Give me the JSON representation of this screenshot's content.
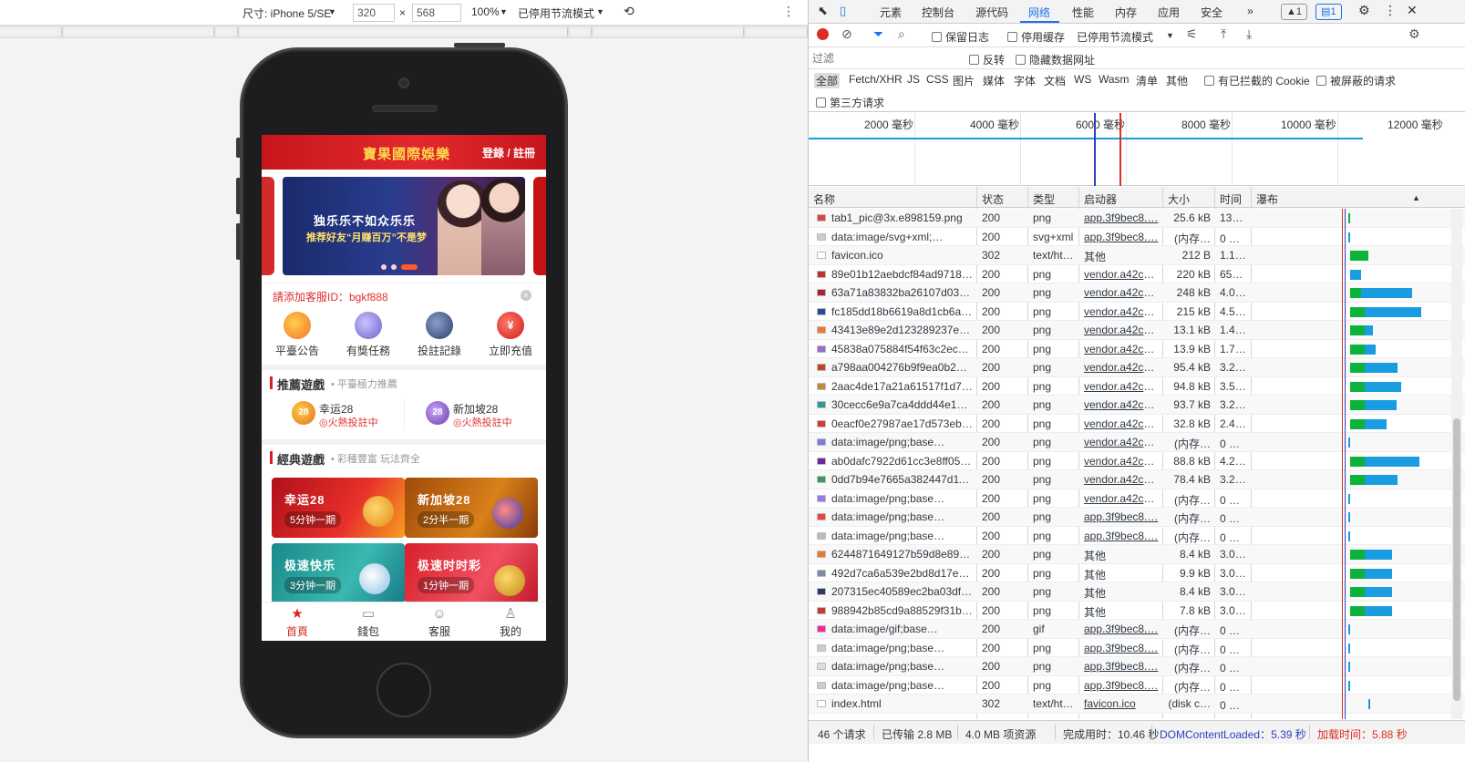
{
  "emulation": {
    "device_label": "尺寸: iPhone 5/SE",
    "width": "320",
    "height": "568",
    "times": "×",
    "zoom": "100%",
    "throttle": "已停用节流模式",
    "more": "⋮",
    "rotate": "⟲"
  },
  "app": {
    "title": "寶果國際娛樂",
    "login": "登錄 / 註冊",
    "banner_line1": "独乐乐不如众乐乐",
    "banner_line2": "推荐好友“月赚百万”不是梦",
    "notice": "請添加客服ID：bgkf888",
    "notice_close": "×",
    "quick": [
      {
        "label": "平臺公告",
        "icon": "smile-icon"
      },
      {
        "label": "有獎任務",
        "icon": "gift-stack-icon"
      },
      {
        "label": "投註記錄",
        "icon": "record-icon"
      },
      {
        "label": "立即充值",
        "icon": "yen-icon"
      }
    ],
    "rec_title": "推薦遊戲",
    "rec_sub": "• 平臺極力推薦",
    "rec": [
      {
        "name": "幸运28",
        "status": "◎火熱投註中",
        "ball": "28"
      },
      {
        "name": "新加坡28",
        "status": "◎火熱投註中",
        "ball": "28"
      }
    ],
    "classic_title": "經典遊戲",
    "classic_sub": "• 彩種豐富 玩法齊全",
    "games": [
      {
        "name": "幸运28",
        "period": "5分钟一期"
      },
      {
        "name": "新加坡28",
        "period": "2分半一期"
      },
      {
        "name": "极速快乐",
        "period": "3分钟一期"
      },
      {
        "name": "极速时时彩",
        "period": "1分钟一期"
      }
    ],
    "tabs": [
      {
        "label": "首頁",
        "icon": "★"
      },
      {
        "label": "錢包",
        "icon": "▭"
      },
      {
        "label": "客服",
        "icon": "☺"
      },
      {
        "label": "我的",
        "icon": "♙"
      }
    ]
  },
  "devtools": {
    "tabs": [
      "元素",
      "控制台",
      "源代码",
      "网络",
      "性能",
      "内存",
      "应用",
      "安全"
    ],
    "tab_more": "»",
    "warn_badge": "▲1",
    "msg_badge": "▤1",
    "toolbar": {
      "preserve_log": "保留日志",
      "disable_cache": "停用缓存",
      "throttle": "已停用节流模式"
    },
    "filter_placeholder": "过滤",
    "invert": "反转",
    "hide_data_urls": "隐藏数据网址",
    "types": [
      "全部",
      "Fetch/XHR",
      "JS",
      "CSS",
      "图片",
      "媒体",
      "字体",
      "文档",
      "WS",
      "Wasm",
      "清单",
      "其他"
    ],
    "blocked_cookies": "有已拦截的 Cookie",
    "blocked_requests": "被屏蔽的请求",
    "third_party": "第三方请求",
    "timeline_ticks": [
      "2000 毫秒",
      "4000 毫秒",
      "6000 毫秒",
      "8000 毫秒",
      "10000 毫秒",
      "12000 毫秒"
    ],
    "columns": [
      "名称",
      "状态",
      "类型",
      "启动器",
      "大小",
      "时间",
      "瀑布"
    ],
    "rows": [
      {
        "name": "tab1_pic@3x.e898159.png",
        "status": "200",
        "type": "png",
        "initiator": "app.3f9bec8.…",
        "size": "25.6 kB",
        "time": "136 …",
        "icon": "#d44",
        "wf_start": 0.0,
        "wf_green": 0.03,
        "wf_blue": 0.0
      },
      {
        "name": "data:image/svg+xml;…",
        "status": "200",
        "type": "svg+xml",
        "initiator": "app.3f9bec8.…",
        "size": "(内存…",
        "time": "0 毫…",
        "icon": "#ccc",
        "wf_start": 0.0,
        "wf_green": 0.0,
        "wf_blue": 0.01
      },
      {
        "name": "favicon.ico",
        "status": "302",
        "type": "text/ht…",
        "initiator": "其他",
        "size": "212 B",
        "time": "1.18…",
        "icon": "#fff",
        "wf_start": 0.02,
        "wf_green": 0.25,
        "wf_blue": 0.0
      },
      {
        "name": "89e01b12aebdcf84ad97187…",
        "status": "200",
        "type": "png",
        "initiator": "vendor.a42c2e…",
        "size": "220 kB",
        "time": "659 …",
        "icon": "#b33",
        "wf_start": 0.02,
        "wf_green": 0.0,
        "wf_blue": 0.15
      },
      {
        "name": "63a71a83832ba26107d0385…",
        "status": "200",
        "type": "png",
        "initiator": "vendor.a42c2e…",
        "size": "248 kB",
        "time": "4.03…",
        "icon": "#a23",
        "wf_start": 0.02,
        "wf_green": 0.15,
        "wf_blue": 0.7
      },
      {
        "name": "fc185dd18b6619a8d1cb6a5…",
        "status": "200",
        "type": "png",
        "initiator": "vendor.a42c2e…",
        "size": "215 kB",
        "time": "4.55…",
        "icon": "#2a4c9a",
        "wf_start": 0.02,
        "wf_green": 0.2,
        "wf_blue": 0.78
      },
      {
        "name": "43413e89e2d123289237e07…",
        "status": "200",
        "type": "png",
        "initiator": "vendor.a42c2e…",
        "size": "13.1 kB",
        "time": "1.47…",
        "icon": "#e87a2a",
        "wf_start": 0.02,
        "wf_green": 0.2,
        "wf_blue": 0.12
      },
      {
        "name": "45838a075884f54f63c2ecd9…",
        "status": "200",
        "type": "png",
        "initiator": "vendor.a42c2e…",
        "size": "13.9 kB",
        "time": "1.70…",
        "icon": "#9a6acd",
        "wf_start": 0.02,
        "wf_green": 0.2,
        "wf_blue": 0.15
      },
      {
        "name": "a798aa004276b9f9ea0b2a4…",
        "status": "200",
        "type": "png",
        "initiator": "vendor.a42c2e…",
        "size": "95.4 kB",
        "time": "3.28…",
        "icon": "#c4402a",
        "wf_start": 0.02,
        "wf_green": 0.2,
        "wf_blue": 0.45
      },
      {
        "name": "2aac4de17a21a61517f1d7aa…",
        "status": "200",
        "type": "png",
        "initiator": "vendor.a42c2e…",
        "size": "94.8 kB",
        "time": "3.51…",
        "icon": "#c08a3a",
        "wf_start": 0.02,
        "wf_green": 0.2,
        "wf_blue": 0.5
      },
      {
        "name": "30cecc6e9a7ca4ddd44e13f3b…",
        "status": "200",
        "type": "png",
        "initiator": "vendor.a42c2e…",
        "size": "93.7 kB",
        "time": "3.26…",
        "icon": "#2a9a9a",
        "wf_start": 0.02,
        "wf_green": 0.2,
        "wf_blue": 0.44
      },
      {
        "name": "0eacf0e27987ae17d573eb41…",
        "status": "200",
        "type": "png",
        "initiator": "vendor.a42c2e…",
        "size": "32.8 kB",
        "time": "2.49…",
        "icon": "#d83a3a",
        "wf_start": 0.02,
        "wf_green": 0.2,
        "wf_blue": 0.3
      },
      {
        "name": "data:image/png;base…",
        "status": "200",
        "type": "png",
        "initiator": "vendor.a42c2e…",
        "size": "(内存…",
        "time": "0 毫…",
        "icon": "#7a7aea",
        "wf_start": 0.0,
        "wf_green": 0.0,
        "wf_blue": 0.01
      },
      {
        "name": "ab0dafc7922d61cc3e8ff05c7…",
        "status": "200",
        "type": "png",
        "initiator": "vendor.a42c2e…",
        "size": "88.8 kB",
        "time": "4.28…",
        "icon": "#6a2a9a",
        "wf_start": 0.02,
        "wf_green": 0.2,
        "wf_blue": 0.75
      },
      {
        "name": "0dd7b94e7665a382447d11d…",
        "status": "200",
        "type": "png",
        "initiator": "vendor.a42c2e…",
        "size": "78.4 kB",
        "time": "3.28…",
        "icon": "#3a9a5a",
        "wf_start": 0.02,
        "wf_green": 0.2,
        "wf_blue": 0.45
      },
      {
        "name": "data:image/png;base…",
        "status": "200",
        "type": "png",
        "initiator": "vendor.a42c2e…",
        "size": "(内存…",
        "time": "0 毫…",
        "icon": "#9a7aea",
        "wf_start": 0.0,
        "wf_green": 0.0,
        "wf_blue": 0.01
      },
      {
        "name": "data:image/png;base…",
        "status": "200",
        "type": "png",
        "initiator": "app.3f9bec8.…",
        "size": "(内存…",
        "time": "0 毫…",
        "icon": "#e44",
        "wf_start": 0.0,
        "wf_green": 0.0,
        "wf_blue": 0.01
      },
      {
        "name": "data:image/png;base…",
        "status": "200",
        "type": "png",
        "initiator": "app.3f9bec8.…",
        "size": "(内存…",
        "time": "0 毫…",
        "icon": "#bbb",
        "wf_start": 0.0,
        "wf_green": 0.0,
        "wf_blue": 0.01
      },
      {
        "name": "6244871649127b59d8e890e…",
        "status": "200",
        "type": "png",
        "initiator": "其他",
        "size": "8.4 kB",
        "time": "3.01…",
        "icon": "#e87a2a",
        "wf_start": 0.02,
        "wf_green": 0.2,
        "wf_blue": 0.38
      },
      {
        "name": "492d7ca6a539e2bd8d17e49…",
        "status": "200",
        "type": "png",
        "initiator": "其他",
        "size": "9.9 kB",
        "time": "3.01…",
        "icon": "#7a8aaa",
        "wf_start": 0.02,
        "wf_green": 0.2,
        "wf_blue": 0.38
      },
      {
        "name": "207315ec40589ec2ba03df76…",
        "status": "200",
        "type": "png",
        "initiator": "其他",
        "size": "8.4 kB",
        "time": "3.02…",
        "icon": "#2a3a6a",
        "wf_start": 0.02,
        "wf_green": 0.2,
        "wf_blue": 0.38
      },
      {
        "name": "988942b85cd9a88529f31bb…",
        "status": "200",
        "type": "png",
        "initiator": "其他",
        "size": "7.8 kB",
        "time": "3.02…",
        "icon": "#c43a3a",
        "wf_start": 0.02,
        "wf_green": 0.2,
        "wf_blue": 0.38
      },
      {
        "name": "data:image/gif;base…",
        "status": "200",
        "type": "gif",
        "initiator": "app.3f9bec8.…",
        "size": "(内存…",
        "time": "0 毫…",
        "icon": "#f29",
        "wf_start": 0.0,
        "wf_green": 0.0,
        "wf_blue": 0.01
      },
      {
        "name": "data:image/png;base…",
        "status": "200",
        "type": "png",
        "initiator": "app.3f9bec8.…",
        "size": "(内存…",
        "time": "0 毫…",
        "icon": "#ccc",
        "wf_start": 0.0,
        "wf_green": 0.0,
        "wf_blue": 0.01
      },
      {
        "name": "data:image/png;base…",
        "status": "200",
        "type": "png",
        "initiator": "app.3f9bec8.…",
        "size": "(内存…",
        "time": "0 毫…",
        "icon": "#ddd",
        "wf_start": 0.0,
        "wf_green": 0.0,
        "wf_blue": 0.01
      },
      {
        "name": "data:image/png;base…",
        "status": "200",
        "type": "png",
        "initiator": "app.3f9bec8.…",
        "size": "(内存…",
        "time": "0 毫…",
        "icon": "#ccc",
        "wf_start": 0.0,
        "wf_green": 0.0,
        "wf_blue": 0.01
      },
      {
        "name": "index.html",
        "status": "302",
        "type": "text/ht…",
        "initiator": "favicon.ico",
        "size": "(disk c…",
        "time": "0 毫…",
        "icon": "#fff",
        "wf_start": 0.28,
        "wf_green": 0.0,
        "wf_blue": 0.01
      }
    ],
    "status": {
      "requests": "46 个请求",
      "transferred": "已传输 2.8 MB",
      "resources": "4.0 MB 项资源",
      "finish": "完成用时：10.46 秒",
      "dcl": "DOMContentLoaded：5.39 秒",
      "load": "加载时间：5.88 秒"
    },
    "colors": {
      "accent": "#1a73e8",
      "dcl": "#2c3fbf",
      "load": "#d93025",
      "green": "#0bb33b",
      "blue": "#1a9de0"
    }
  }
}
